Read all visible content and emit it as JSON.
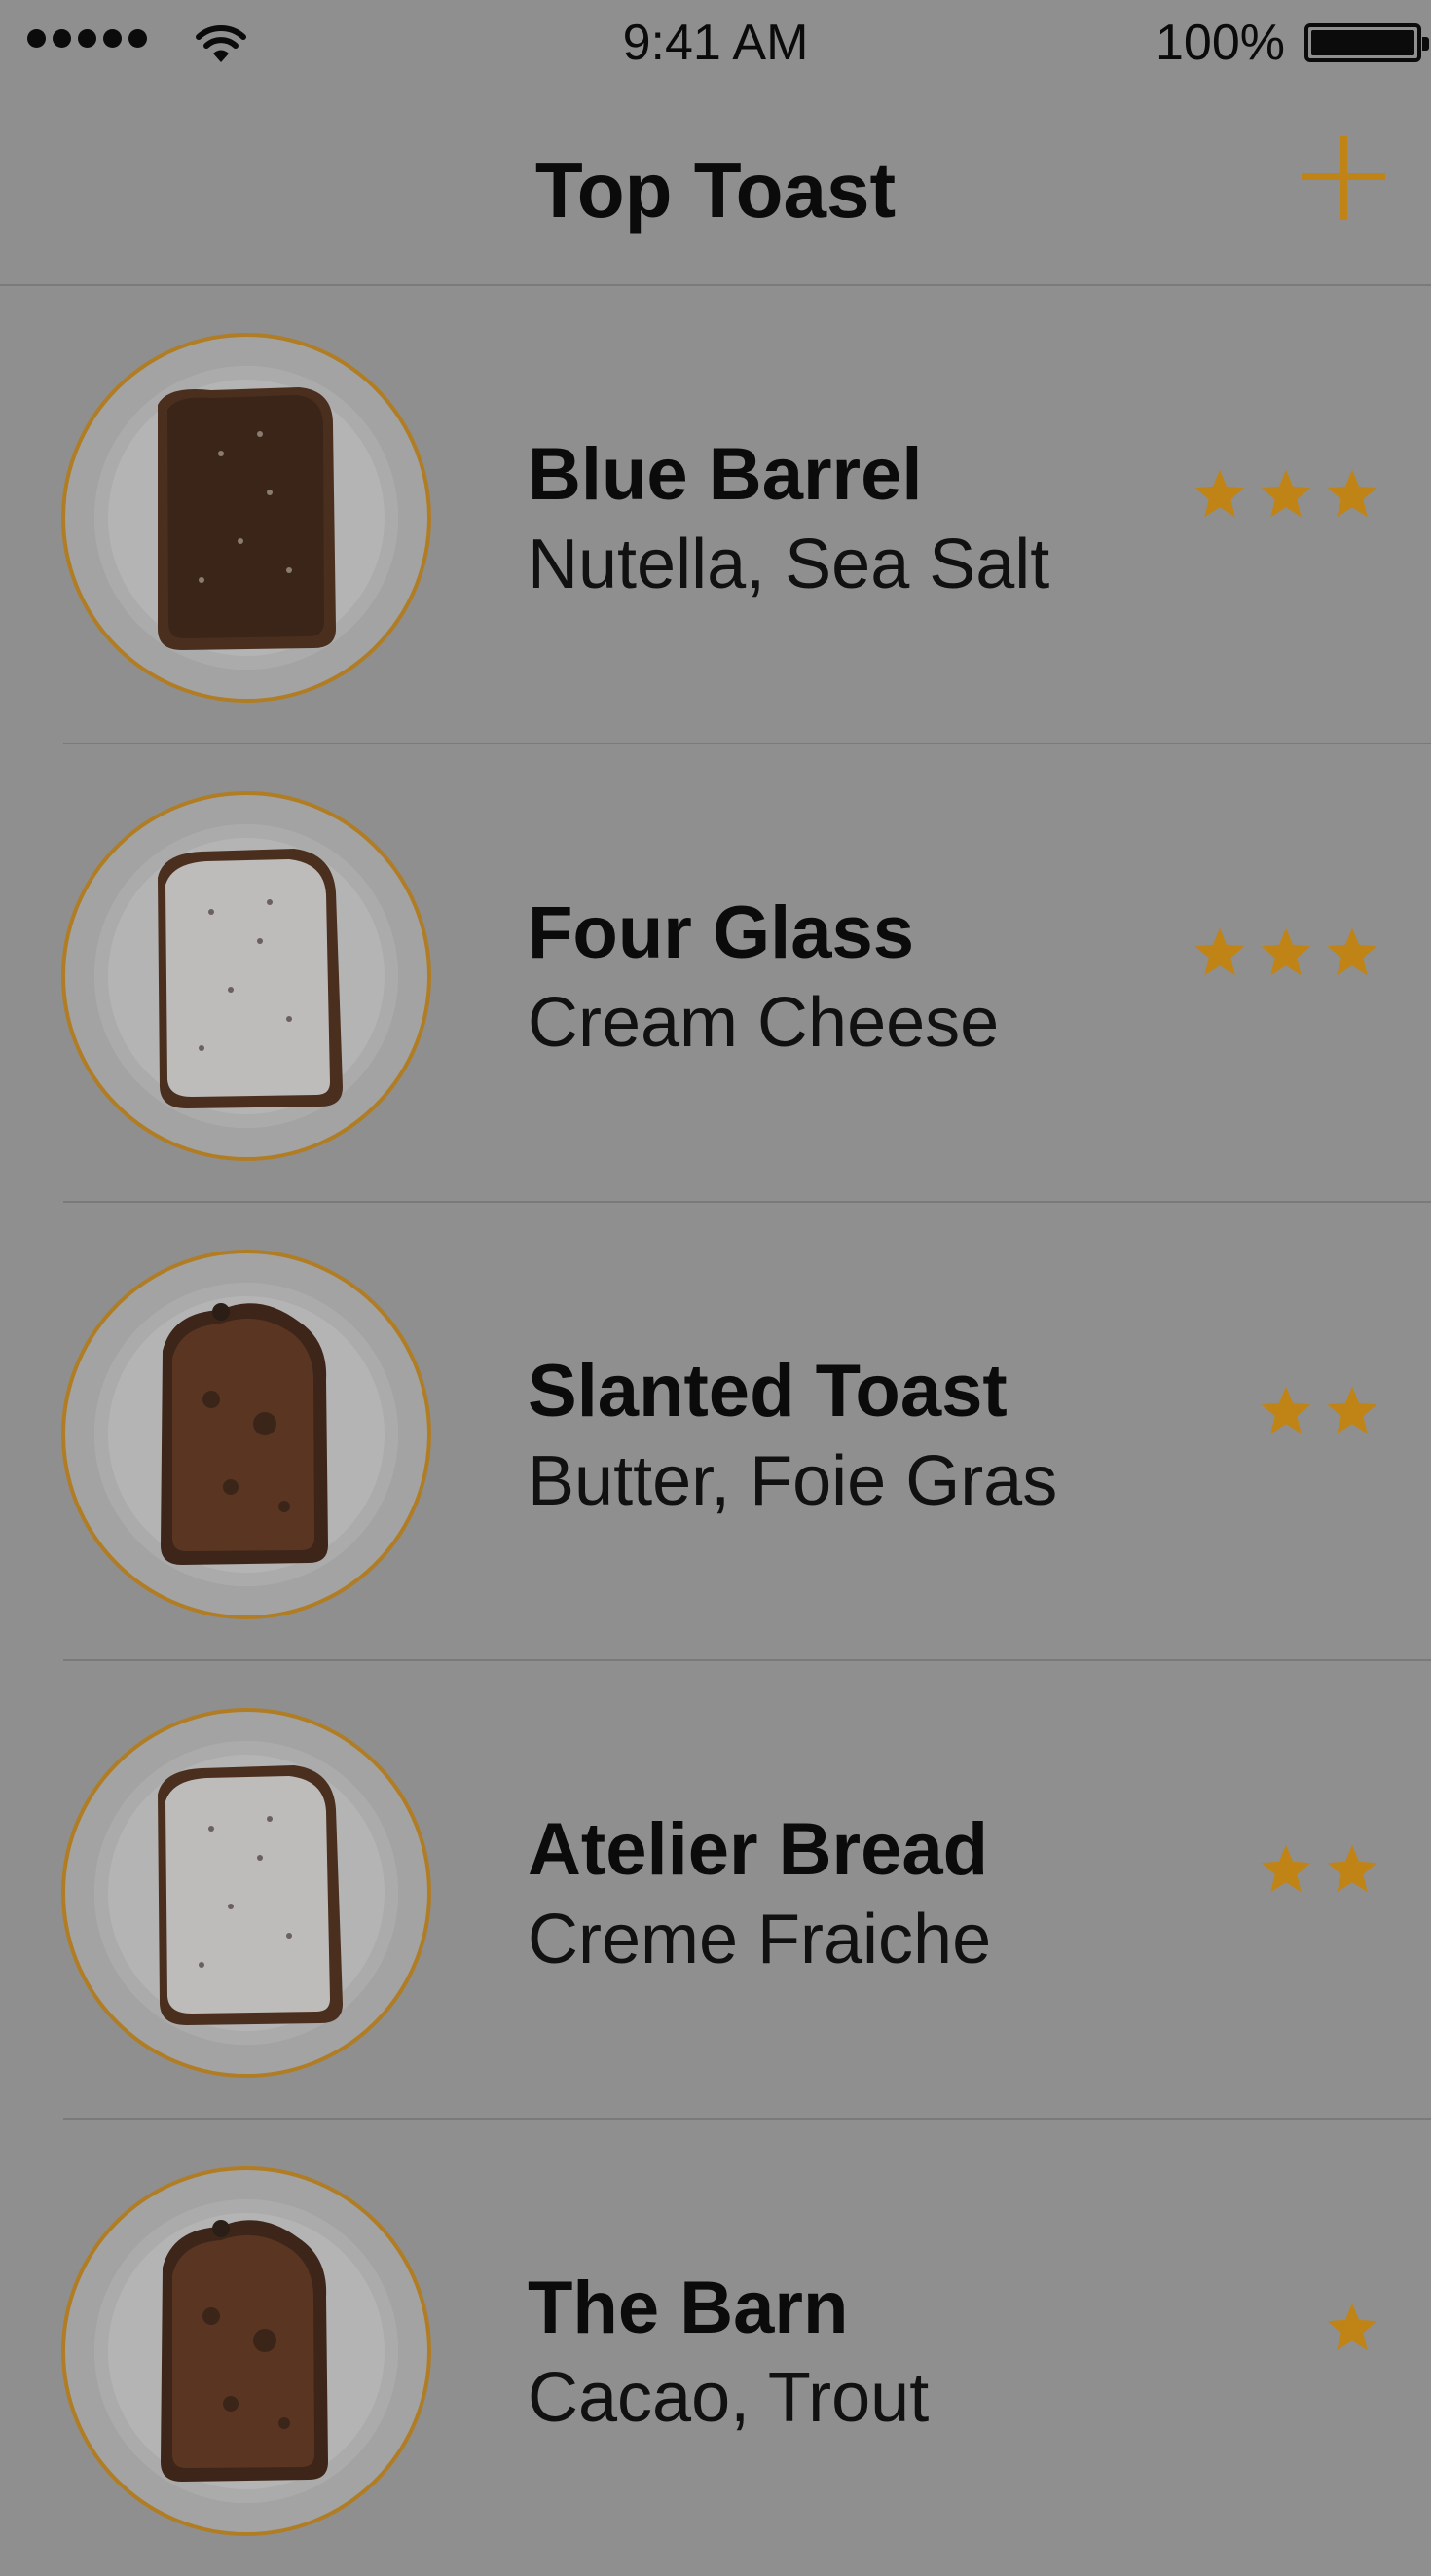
{
  "status_bar": {
    "time": "9:41 AM",
    "battery_percent": "100%",
    "signal_bars": 5,
    "battery_level": 1.0
  },
  "nav": {
    "title": "Top Toast",
    "add_icon": "plus-icon"
  },
  "colors": {
    "accent": "#c08416",
    "plate_ring": "#b07d24",
    "background": "#8f8f8f"
  },
  "items": [
    {
      "name": "Blue Barrel",
      "toppings": "Nutella, Sea Salt",
      "rating": 3,
      "toast_icon": "nutella-toast"
    },
    {
      "name": "Four Glass",
      "toppings": "Cream Cheese",
      "rating": 3,
      "toast_icon": "cream-cheese-toast"
    },
    {
      "name": "Slanted Toast",
      "toppings": "Butter, Foie Gras",
      "rating": 2,
      "toast_icon": "plain-toast"
    },
    {
      "name": "Atelier Bread",
      "toppings": "Creme Fraiche",
      "rating": 2,
      "toast_icon": "cream-cheese-toast"
    },
    {
      "name": "The Barn",
      "toppings": "Cacao, Trout",
      "rating": 1,
      "toast_icon": "plain-toast"
    }
  ]
}
